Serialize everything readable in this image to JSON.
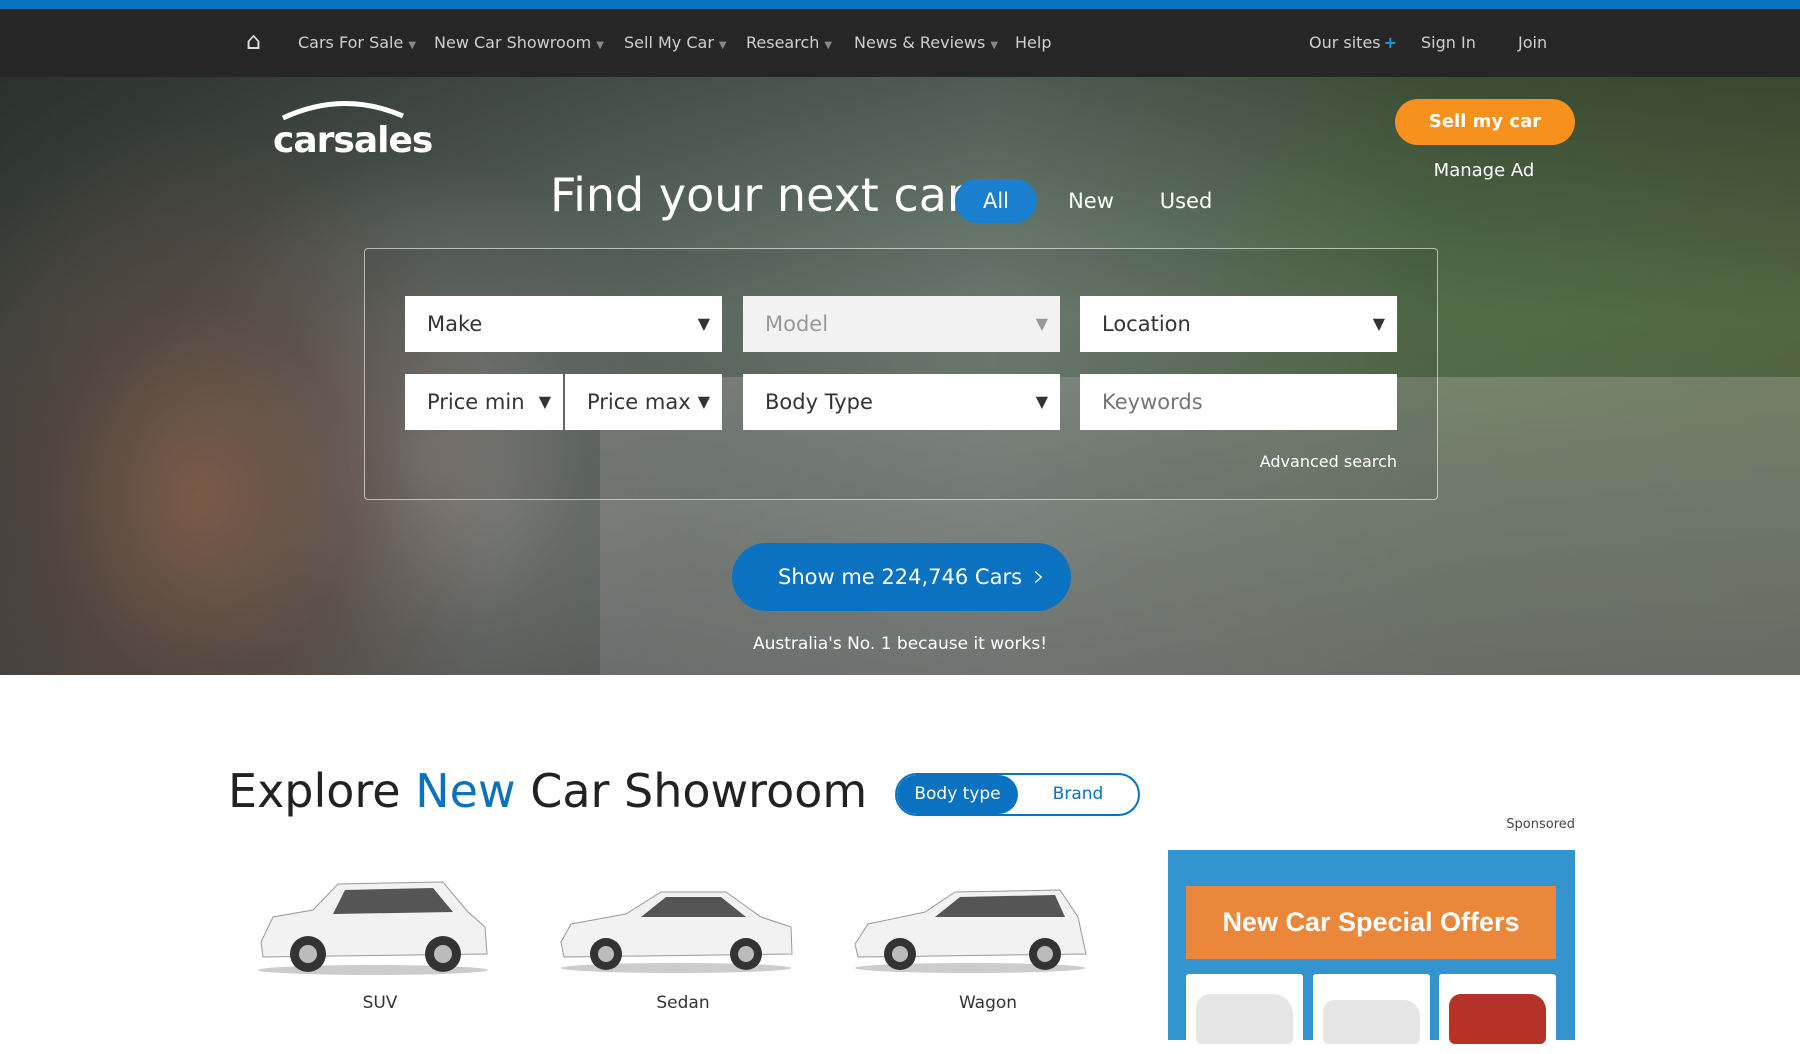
{
  "nav": {
    "items": [
      {
        "label": "Cars For Sale",
        "dropdown": true
      },
      {
        "label": "New Car Showroom",
        "dropdown": true
      },
      {
        "label": "Sell My Car",
        "dropdown": true
      },
      {
        "label": "Research",
        "dropdown": true
      },
      {
        "label": "News & Reviews",
        "dropdown": true
      },
      {
        "label": "Help",
        "dropdown": false
      }
    ],
    "our_sites": "Our sites",
    "sign_in": "Sign In",
    "join": "Join",
    "home_icon": "home-icon"
  },
  "hero": {
    "logo": "carsales",
    "sell_button": "Sell my car",
    "manage_ad": "Manage Ad",
    "title": "Find your next car",
    "tabs": [
      {
        "label": "All",
        "active": true
      },
      {
        "label": "New"
      },
      {
        "label": "Used"
      }
    ],
    "fields": {
      "make": "Make",
      "model": "Model",
      "location": "Location",
      "price_min": "Price min",
      "price_max": "Price max",
      "body_type": "Body Type",
      "keywords_placeholder": "Keywords"
    },
    "advanced_search": "Advanced search",
    "show_button": "Show me 224,746 Cars",
    "tagline": "Australia's No. 1 because it works!"
  },
  "explore": {
    "title_pre": "Explore ",
    "title_highlight": "New",
    "title_post": " Car Showroom",
    "toggle": [
      {
        "label": "Body type",
        "active": true
      },
      {
        "label": "Brand"
      }
    ],
    "body_types": [
      {
        "label": "SUV"
      },
      {
        "label": "Sedan"
      },
      {
        "label": "Wagon"
      }
    ]
  },
  "ad": {
    "sponsored": "Sponsored",
    "headline": "New Car Special Offers"
  },
  "colors": {
    "brand_blue": "#0a72c0",
    "orange": "#f7911e",
    "nav_bg": "#262626"
  }
}
